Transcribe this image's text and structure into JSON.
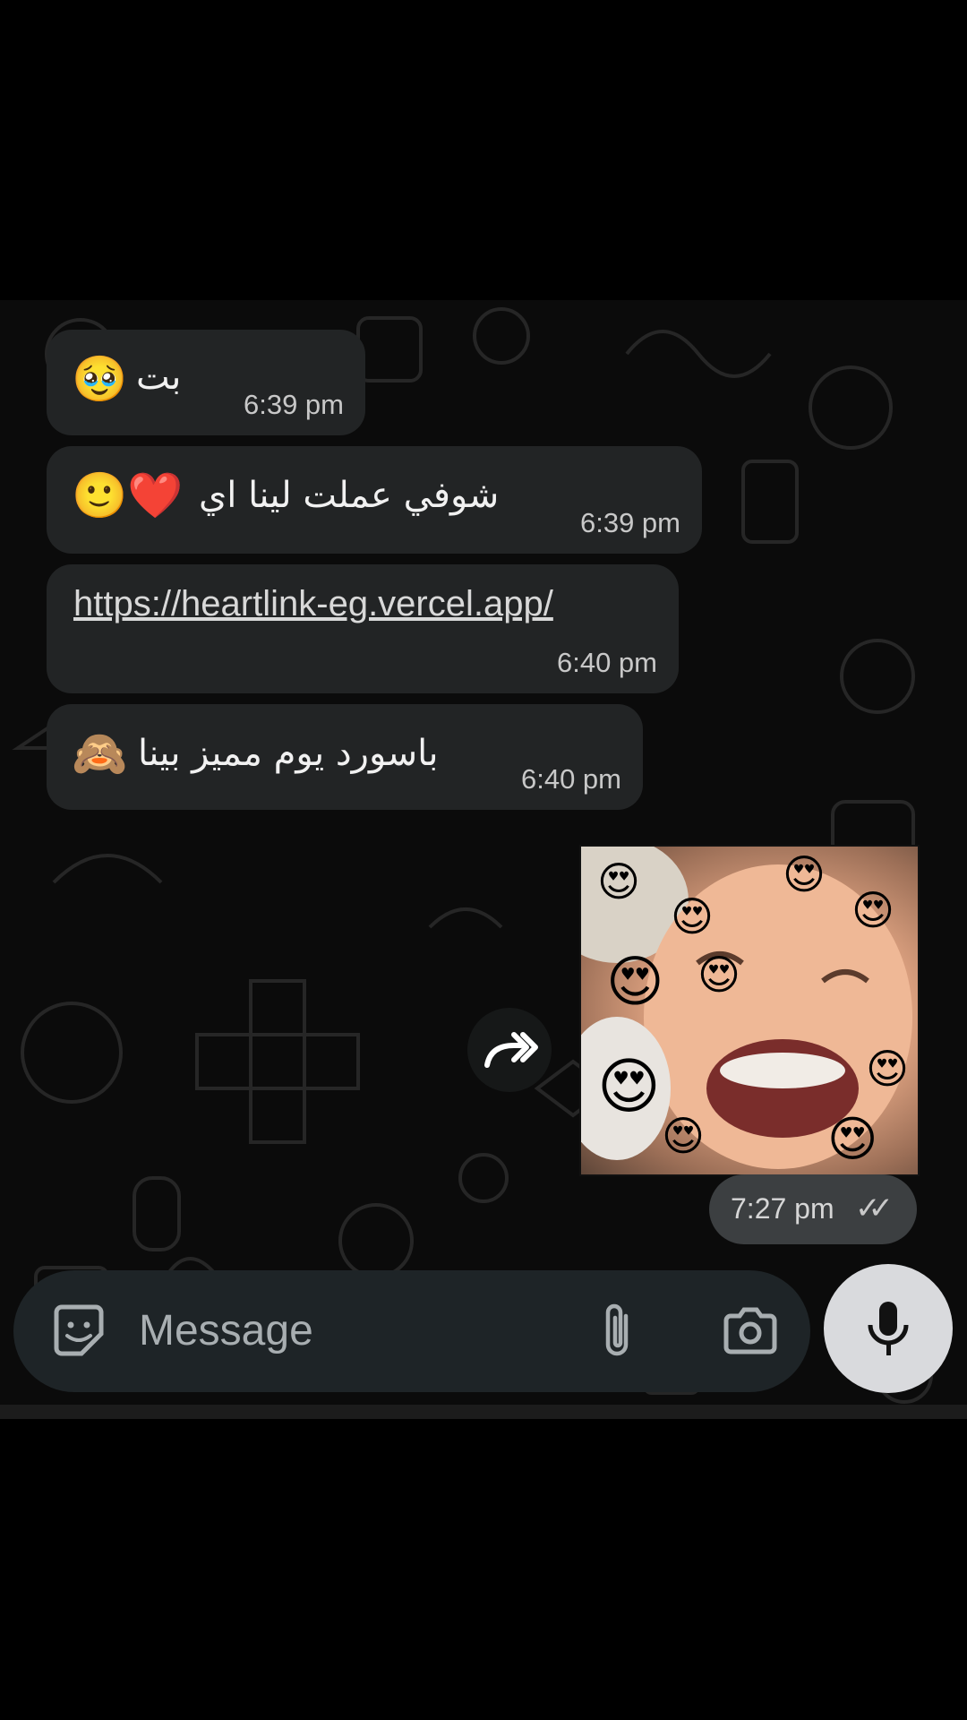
{
  "messages": [
    {
      "text": "بت",
      "emoji": "🥹",
      "time": "6:39 pm"
    },
    {
      "text": "شوفي عملت لينا اي",
      "emoji": "🙂❤️",
      "time": "6:39 pm"
    },
    {
      "link": "https://heartlink-eg.vercel.app/",
      "time": "6:40 pm"
    },
    {
      "text": "باسورد يوم مميز بينا",
      "emoji": "🙈",
      "time": "6:40 pm"
    }
  ],
  "sent_image": {
    "time": "7:27 pm",
    "status_icon": "double-check-icon",
    "overlay_emoji": "😍"
  },
  "input": {
    "placeholder": "Message",
    "icons": [
      "sticker-icon",
      "attach-icon",
      "camera-icon",
      "mic-icon"
    ]
  },
  "forward_icon": "forward-icon"
}
